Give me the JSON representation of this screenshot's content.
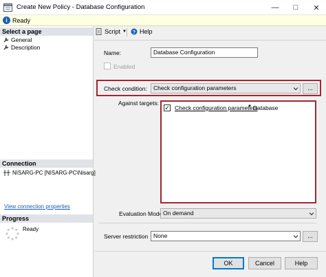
{
  "window": {
    "title": "Create New Policy - Database Configuration",
    "minimize_glyph": "—",
    "maximize_glyph": "□",
    "close_glyph": "✕"
  },
  "status": {
    "text": "Ready",
    "icon": "info-icon"
  },
  "left_pane": {
    "select_page_header": "Select a page",
    "pages": [
      {
        "label": "General",
        "icon": "wrench-icon"
      },
      {
        "label": "Description",
        "icon": "wrench-icon"
      }
    ],
    "connection_header": "Connection",
    "connection_text": "NISARG-PC [NISARG-PC\\Nisarg]",
    "view_connection_link": "View connection properties",
    "progress_header": "Progress",
    "progress_text": "Ready"
  },
  "toolbar": {
    "script_label": "Script",
    "help_label": "Help"
  },
  "form": {
    "name_label": "Name:",
    "name_value": "Database Configuration",
    "enabled_label": "Enabled",
    "enabled_checked": false,
    "check_condition_label": "Check condition:",
    "check_condition_value": "Check configuration parameters",
    "ellipsis_label": "...",
    "against_targets_label": "Against targets:",
    "targets": [
      {
        "checked": true,
        "condition": "Check configuration parameters",
        "target": "Database"
      }
    ],
    "evaluation_mode_label": "Evaluation Mode:",
    "evaluation_mode_value": "On demand",
    "server_restriction_label": "Server restriction",
    "server_restriction_value": "None",
    "server_restriction_ellipsis": "..."
  },
  "buttons": {
    "ok": "OK",
    "cancel": "Cancel",
    "help": "Help"
  },
  "colors": {
    "highlight_border": "#a4262c",
    "link": "#1a5fb4",
    "status_bg": "#ffffe1"
  }
}
